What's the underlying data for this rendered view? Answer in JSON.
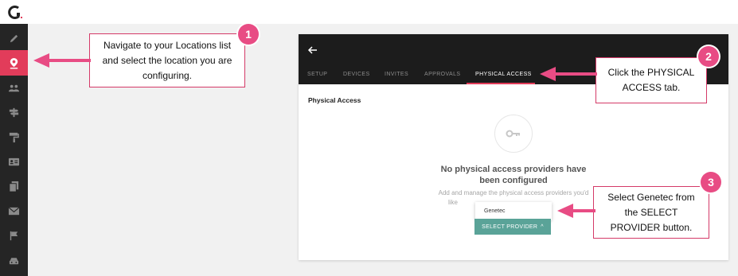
{
  "callouts": [
    {
      "number": "1",
      "text": "Navigate to your Locations list and select the location you are configuring."
    },
    {
      "number": "2",
      "text": "Click the PHYSICAL ACCESS tab."
    },
    {
      "number": "3",
      "text": "Select Genetec from the SELECT PROVIDER button."
    }
  ],
  "panel": {
    "tabs": [
      "SETUP",
      "DEVICES",
      "INVITES",
      "APPROVALS",
      "PHYSICAL ACCESS"
    ],
    "active_tab": "PHYSICAL ACCESS",
    "section_title": "Physical Access",
    "empty_title": "No physical access providers have been configured",
    "empty_desc_start": "Add and manage the physical access providers you'd",
    "empty_desc_end": "like",
    "dropdown_option": "Genetec",
    "select_button": "SELECT PROVIDER",
    "select_caret": "^"
  },
  "colors": {
    "accent": "#e23c5a",
    "badge": "#e84c84",
    "button": "#5aa398"
  },
  "icons": {
    "sidebar": [
      "pencil-icon",
      "location-pin-icon",
      "people-icon",
      "signpost-icon",
      "paint-roller-icon",
      "id-card-icon",
      "documents-icon",
      "mail-icon",
      "flag-icon",
      "car-icon"
    ],
    "empty_state": "key-icon"
  }
}
